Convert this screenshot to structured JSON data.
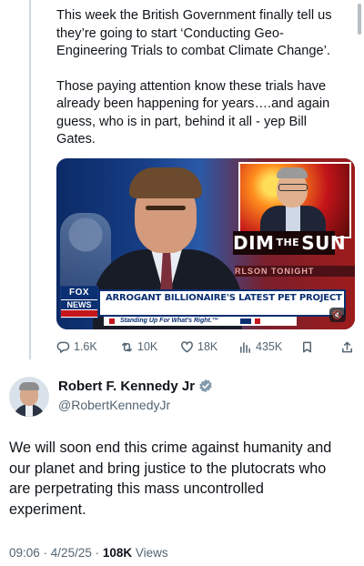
{
  "quoted_post": {
    "paragraph_1": "This week the British Government finally tell us\nthey’re going to start ‘Conducting Geo-\nEngineering Trials to combat Climate Change’.",
    "paragraph_2": "Those paying attention know these trials have\nalready been happening for years….and again\nguess, who is in part, behind it all - yep Bill\nGates.",
    "media": {
      "dim_banner_left": "DIM",
      "dim_banner_mid": "THE",
      "dim_banner_right": "SUN",
      "ticker_text": "RLSON TONIGHT",
      "network_logo_top": "FOX",
      "network_logo_bottom": "NEWS",
      "headline": "ARROGANT BILLIONAIRE'S LATEST PET PROJECT",
      "tagline": "Standing Up For What's Right.™",
      "sound_icon": "speaker-muted-icon"
    },
    "actions": {
      "replies": "1.6K",
      "reposts": "10K",
      "likes": "18K",
      "views": "435K"
    }
  },
  "reply": {
    "author_name": "Robert F. Kennedy Jr",
    "handle": "@RobertKennedyJr",
    "verified_color": "#829aab",
    "text": "We will soon end this crime against humanity and\nour planet and bring justice to the plutocrats who\nare perpetrating this mass uncontrolled\nexperiment.",
    "time": "09:06",
    "date": "4/25/25",
    "views_count": "108K",
    "views_label": "Views"
  }
}
